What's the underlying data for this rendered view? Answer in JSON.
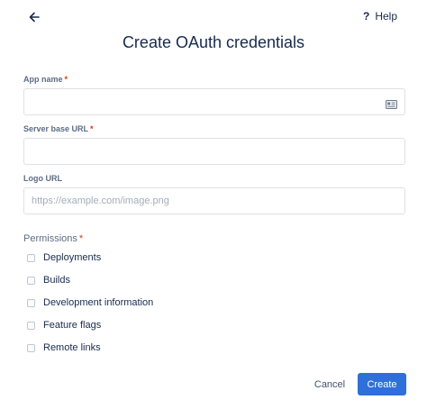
{
  "header": {
    "back_icon": "arrow-left-icon",
    "help_icon": "question-mark-icon",
    "help_label": "Help"
  },
  "title": "Create OAuth credentials",
  "form": {
    "app_name": {
      "label": "App name",
      "required_mark": "*",
      "value": "",
      "icon": "contact-card-icon"
    },
    "server_base_url": {
      "label": "Server base URL",
      "required_mark": "*",
      "value": ""
    },
    "logo_url": {
      "label": "Logo URL",
      "value": "",
      "placeholder": "https://example.com/image.png"
    }
  },
  "permissions": {
    "label": "Permissions",
    "required_mark": "*",
    "options": [
      {
        "label": "Deployments",
        "checked": false
      },
      {
        "label": "Builds",
        "checked": false
      },
      {
        "label": "Development information",
        "checked": false
      },
      {
        "label": "Feature flags",
        "checked": false
      },
      {
        "label": "Remote links",
        "checked": false
      }
    ]
  },
  "actions": {
    "cancel_label": "Cancel",
    "create_label": "Create"
  },
  "colors": {
    "primary": "#2f6fd9",
    "required": "#de350b",
    "text": "#172b4d",
    "label": "#5e6c84"
  }
}
